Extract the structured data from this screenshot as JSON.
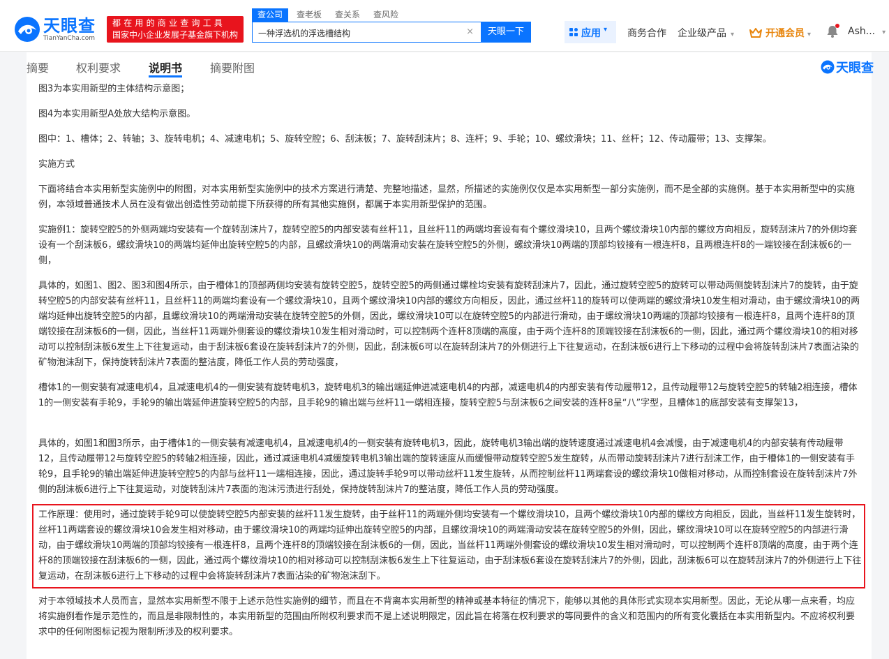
{
  "header": {
    "logo_cn": "天眼查",
    "logo_en": "TianYanCha.com",
    "slogan_line1": "都在用的商业查询工具",
    "slogan_line2": "国家中小企业发展子基金旗下机构",
    "search_tabs": [
      "查公司",
      "查老板",
      "查关系",
      "查风险"
    ],
    "search_value": "一种浮选机的浮选槽结构",
    "search_button": "天眼一下",
    "clear_icon": "×",
    "nav_app": "应用",
    "nav_business": "商务合作",
    "nav_enterprise": "企业级产品",
    "nav_vip": "开通会员",
    "user_name": "Ash...",
    "caret": "▾",
    "accent_color": "#0a74ff",
    "slogan_color": "#e8141d",
    "vip_color": "#e8850c"
  },
  "doc_tabs": {
    "items": [
      "摘要",
      "权利要求",
      "说明书",
      "摘要附图"
    ],
    "active": "说明书",
    "brand": "天眼查"
  },
  "content": {
    "p1": "图3为本实用新型的主体结构示意图；",
    "p2": "图4为本实用新型A处放大结构示意图。",
    "p3": "图中：1、槽体；2、转轴；3、旋转电机；4、减速电机；5、旋转空腔；6、刮沫板；7、旋转刮沫片；8、连杆；9、手轮；10、螺纹滑块；11、丝杆；12、传动履带；13、支撑架。",
    "p4": "实施方式",
    "p5": "下面将结合本实用新型实施例中的附图，对本实用新型实施例中的技术方案进行清楚、完整地描述，显然，所描述的实施例仅仅是本实用新型一部分实施例，而不是全部的实施例。基于本实用新型中的实施例，本领域普通技术人员在没有做出创造性劳动前提下所获得的所有其他实施例，都属于本实用新型保护的范围。",
    "p6": "实施例1：旋转空腔5的外侧两端均安装有一个旋转刮沫片7，旋转空腔5的内部安装有丝杆11，且丝杆11的两端均套设有有个螺纹滑块10，且两个螺纹滑块10内部的螺纹方向相反，旋转刮沫片7的外侧均套设有一个刮沫板6，螺纹滑块10的两端均延伸出旋转空腔5的内部，且螺纹滑块10的两端滑动安装在旋转空腔5的外侧，螺纹滑块10两端的顶部均铰接有一根连杆8，且两根连杆8的一端铰接在刮沫板6的一侧，",
    "p7": "具体的，如图1、图2、图3和图4所示，由于槽体1的顶部两侧均安装有旋转空腔5，旋转空腔5的两侧通过螺栓均安装有旋转刮沫片7，因此，通过旋转空腔5的旋转可以带动两侧旋转刮沫片7的旋转，由于旋转空腔5的内部安装有丝杆11，且丝杆11的两端均套设有一个螺纹滑块10，且两个螺纹滑块10内部的螺纹方向相反，因此，通过丝杆11的旋转可以使两端的螺纹滑块10发生相对滑动，由于螺纹滑块10的两端均延伸出旋转空腔5的内部，且螺纹滑块10的两端滑动安装在旋转空腔5的外侧，因此，螺纹滑块10可以在旋转空腔5的内部进行滑动，由于螺纹滑块10两端的顶部均铰接有一根连杆8，且两个连杆8的顶端铰接在刮沫板6的一侧，因此，当丝杆11两端外侧套设的螺纹滑块10发生相对滑动时，可以控制两个连杆8顶端的高度，由于两个连杆8的顶端铰接在刮沫板6的一侧，因此，通过两个螺纹滑块10的相对移动可以控制刮沫板6发生上下往复运动，由于刮沫板6套设在旋转刮沫片7的外侧，因此，刮沫板6可以在旋转刮沫片7的外侧进行上下往复运动，在刮沫板6进行上下移动的过程中会将旋转刮沫片7表面沾染的矿物泡沫刮下，保持旋转刮沫片7表面的整洁度，降低工作人员的劳动强度，",
    "p8": "槽体1的一侧安装有减速电机4，且减速电机4的一侧安装有旋转电机3，旋转电机3的输出端延伸进减速电机4的内部，减速电机4的内部安装有传动履带12，且传动履带12与旋转空腔5的转轴2相连接，槽体1的一侧安装有手轮9，手轮9的输出端延伸进旋转空腔5的内部，且手轮9的输出端与丝杆11一端相连接，旋转空腔5与刮沫板6之间安装的连杆8呈“八”字型，且槽体1的底部安装有支撑架13，",
    "p9": "具体的，如图1和图3所示，由于槽体1的一侧安装有减速电机4，且减速电机4的一侧安装有旋转电机3，因此，旋转电机3输出端的旋转速度通过减速电机4会减慢，由于减速电机4的内部安装有传动履带12，且传动履带12与旋转空腔5的转轴2相连接，因此，通过减速电机4减缓旋转电机3输出端的旋转速度从而缓慢带动旋转空腔5发生旋转，从而带动旋转刮沫片7进行刮沫工作，由于槽体1的一侧安装有手轮9，且手轮9的输出端延伸进旋转空腔5的内部与丝杆11一端相连接，因此，通过旋转手轮9可以带动丝杆11发生旋转，从而控制丝杆11两端套设的螺纹滑块10做相对移动，从而控制套设在旋转刮沫片7外侧的刮沫板6进行上下往复运动，对旋转刮沫片7表面的泡沫污渍进行刮处，保持旋转刮沫片7的整洁度，降低工作人员的劳动强度。",
    "p10": "工作原理：使用时，通过旋转手轮9可以使旋转空腔5内部安装的丝杆11发生旋转，由于丝杆11的两端外侧均安装有一个螺纹滑块10，且两个螺纹滑块10内部的螺纹方向相反，因此，当丝杆11发生旋转时，丝杆11两端套设的螺纹滑块10会发生相对移动，由于螺纹滑块10的两端均延伸出旋转空腔5的内部，且螺纹滑块10的两端滑动安装在旋转空腔5的外侧，因此，螺纹滑块10可以在旋转空腔5的内部进行滑动，由于螺纹滑块10两端的顶部均铰接有一根连杆8，且两个连杆8的顶端铰接在刮沫板6的一侧，因此，当丝杆11两端外侧套设的螺纹滑块10发生相对滑动时，可以控制两个连杆8顶端的高度，由于两个连杆8的顶端铰接在刮沫板6的一侧，因此，通过两个螺纹滑块10的相对移动可以控制刮沫板6发生上下往复运动，由于刮沫板6套设在旋转刮沫片7的外侧，因此，刮沫板6可以在旋转刮沫片7的外侧进行上下往复运动，在刮沫板6进行上下移动的过程中会将旋转刮沫片7表面沾染的矿物泡沫刮下。",
    "p11": "对于本领域技术人员而言，显然本实用新型不限于上述示范性实施例的细节，而且在不背离本实用新型的精神或基本特征的情况下，能够以其他的具体形式实现本实用新型。因此，无论从哪一点来看，均应将实施例看作是示范性的，而且是非限制性的，本实用新型的范围由所附权利要求而不是上述说明限定，因此旨在将落在权利要求的等同要件的含义和范围内的所有变化囊括在本实用新型内。不应将权利要求中的任何附图标记视为限制所涉及的权利要求。"
  }
}
